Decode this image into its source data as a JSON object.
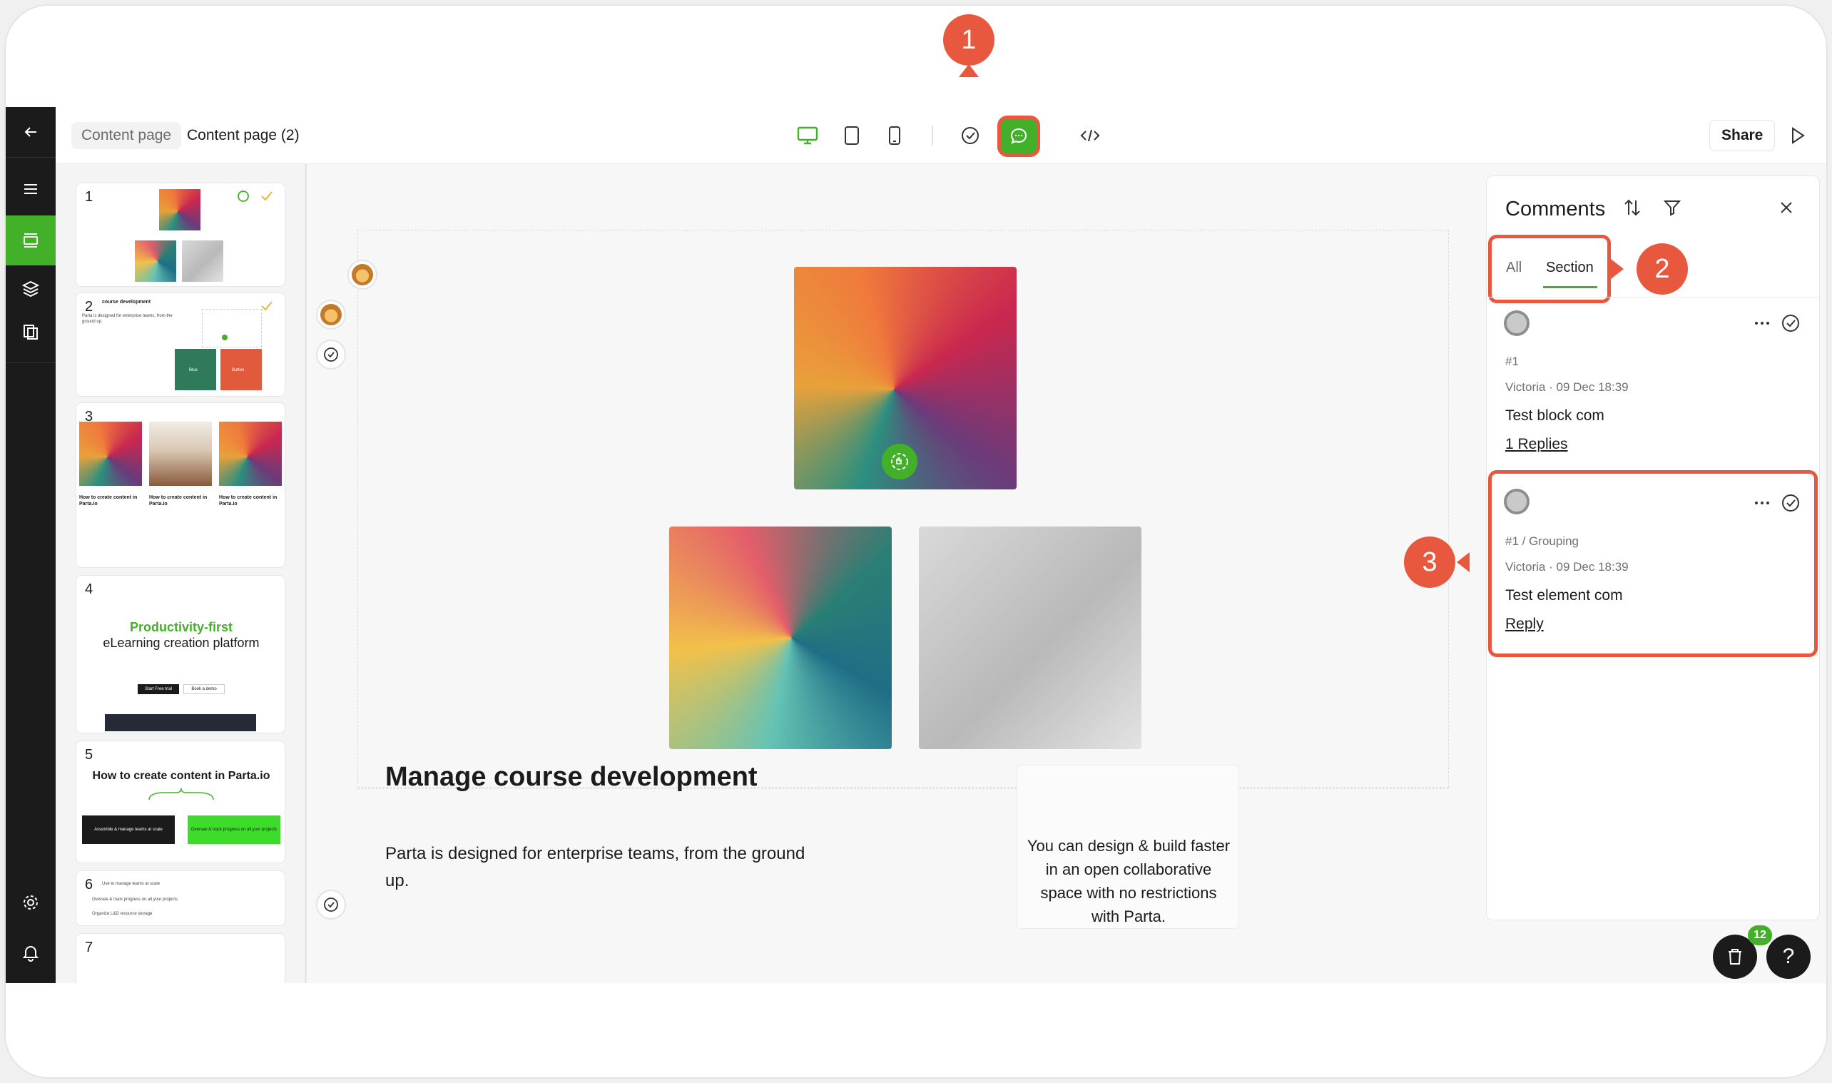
{
  "breadcrumb": {
    "prev": "Content page",
    "current": "Content page (2)"
  },
  "toolbar": {
    "share_label": "Share",
    "icons": [
      "desktop-icon",
      "tablet-icon",
      "mobile-icon",
      "check-circle-icon",
      "comment-icon",
      "code-icon",
      "play-icon"
    ]
  },
  "rail": {
    "icons": [
      "back-arrow-icon",
      "menu-icon",
      "sections-icon",
      "layers-icon",
      "pages-icon",
      "settings-icon",
      "bell-icon"
    ]
  },
  "slides": [
    {
      "num": "1"
    },
    {
      "num": "2",
      "heading": "course development",
      "body": "Parta is designed for enterprise teams, from the ground up.",
      "btn1": "Blue",
      "btn2": "Button"
    },
    {
      "num": "3",
      "cards": [
        {
          "title": "How to create content in Parta.io"
        },
        {
          "title": "How to create content in Parta.io"
        },
        {
          "title": "How to create content in Parta.io"
        }
      ]
    },
    {
      "num": "4",
      "line1": "Productivity-first",
      "line2": "eLearning creation platform",
      "cta1": "Start Free trial",
      "cta2": "Book a demo"
    },
    {
      "num": "5",
      "title": "How to create content in Parta.io",
      "btn1": "Assemble & manage teams at scale",
      "btn2": "Oversee & track progress on all your projects"
    },
    {
      "num": "6",
      "item1": "Use to manage teams at scale",
      "item2": "Oversee & track progress on all your projects",
      "item3": "Organize L&D resource storage"
    },
    {
      "num": "7"
    }
  ],
  "canvas": {
    "title": "Manage course development",
    "body": "Parta is designed for enterprise teams, from the ground up.",
    "card_text": "You can design & build faster in an open collaborative space with no restrictions with Parta."
  },
  "comments_panel": {
    "title": "Comments",
    "tabs": [
      {
        "label": "All",
        "active": false
      },
      {
        "label": "Section",
        "active": true
      }
    ],
    "items": [
      {
        "ref": "#1",
        "author_meta": "Victoria · 09 Dec 18:39",
        "text": "Test block com",
        "action": "1 Replies"
      },
      {
        "ref": "#1 / Grouping",
        "author_meta": "Victoria · 09 Dec 18:39",
        "text": "Test element com",
        "action": "Reply"
      }
    ]
  },
  "floating": {
    "badge_count": "12",
    "help": "?"
  },
  "callouts": {
    "one": "1",
    "two": "2",
    "three": "3"
  },
  "colors": {
    "accent": "#43b02a",
    "callout": "#e8583f",
    "rail": "#1b1b1b"
  }
}
